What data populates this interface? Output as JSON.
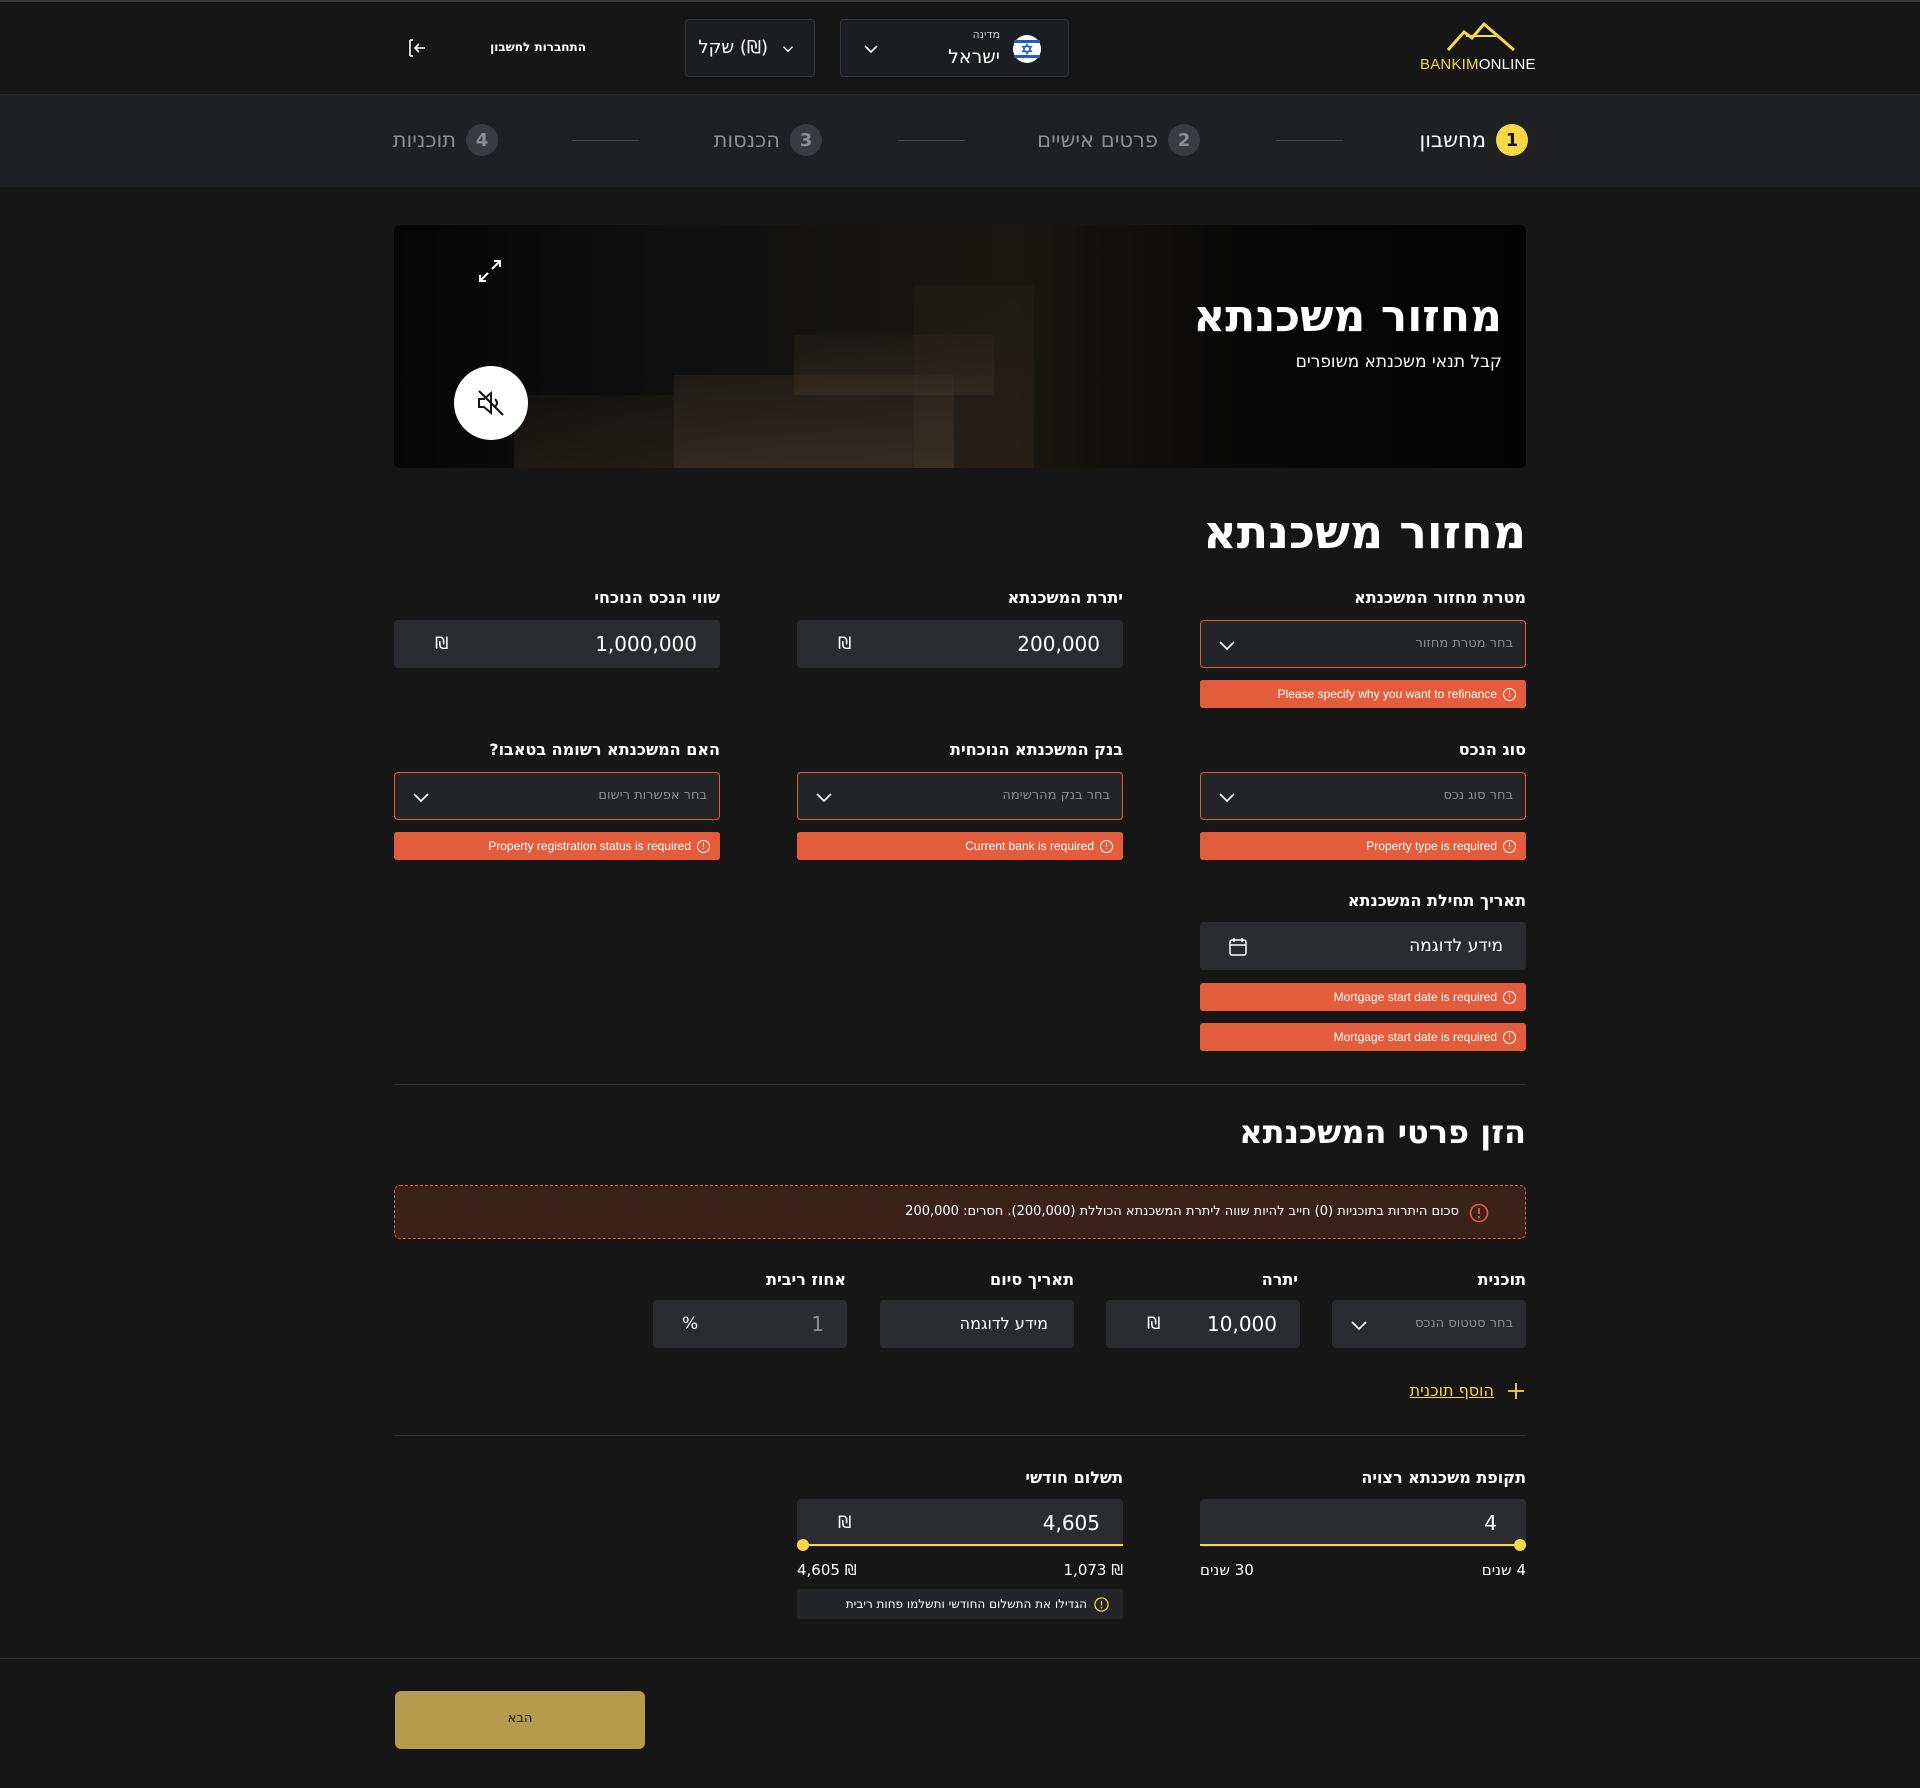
{
  "header": {
    "logo_part1": "BANKIM",
    "logo_part2": "ONLINE",
    "country_label": "מדינה",
    "country_value": "ישראל",
    "currency_value": "(₪) שקל",
    "login_label": "התחברות לחשבון"
  },
  "steps": [
    {
      "num": "1",
      "label": "מחשבון"
    },
    {
      "num": "2",
      "label": "פרטים אישיים"
    },
    {
      "num": "3",
      "label": "הכנסות"
    },
    {
      "num": "4",
      "label": "תוכניות"
    }
  ],
  "hero": {
    "title": "מחזור משכנתא",
    "subtitle": "קבל תנאי משכנתא משופרים"
  },
  "form": {
    "title": "מחזור משכנתא",
    "currency_symbol": "₪",
    "purpose": {
      "label": "מטרת מחזור המשכנתא",
      "placeholder": "בחר מטרת מחזור",
      "error": "Please specify why you want to refinance"
    },
    "balance": {
      "label": "יתרת המשכנתא",
      "value": "200,000"
    },
    "property_value": {
      "label": "שווי הנכס הנוכחי",
      "value": "1,000,000"
    },
    "property_type": {
      "label": "סוג הנכס",
      "placeholder": "בחר סוג נכס",
      "error": "Property type is required"
    },
    "current_bank": {
      "label": "בנק המשכנתא הנוכחית",
      "placeholder": "בחר בנק מהרשימה",
      "error": "Current bank is required"
    },
    "registration": {
      "label": "האם המשכנתא רשומה בטאבו?",
      "placeholder": "בחר אפשרות רישום",
      "error": "Property registration status is required"
    },
    "start_date": {
      "label": "תאריך תחילת המשכנתא",
      "value": "מידע לדוגמה",
      "error1": "Mortgage start date is required",
      "error2": "Mortgage start date is required"
    }
  },
  "details": {
    "title": "הזן פרטי המשכנתא",
    "warning": "סכום היתרות בתוכניות (0) חייב להיות שווה ליתרת המשכנתא הכוללת (200,000). חסרים: 200,000",
    "plan_label": "תוכנית",
    "plan_placeholder": "בחר סטטוס הנכס",
    "balance_label": "יתרה",
    "balance_value": "10,000",
    "end_date_label": "תאריך סיום",
    "end_date_value": "מידע לדוגמה",
    "rate_label": "אחוז ריבית",
    "rate_value": "1",
    "rate_symbol": "%",
    "add_plan": "הוסף תוכנית"
  },
  "period": {
    "label": "תקופת משכנתא רצויה",
    "value": "4",
    "min_label": "4 שנים",
    "max_label": "30 שנים",
    "slider_fraction": 0.0
  },
  "payment": {
    "label": "תשלום חודשי",
    "value": "4,605",
    "min_label": "₪ 1,073",
    "max_label": "₪ 4,605",
    "slider_fraction": 1.0,
    "hint": "הגדילו את התשלום החודשי ותשלמו פחות ריבית"
  },
  "footer": {
    "next_label": "הבא"
  },
  "colors": {
    "accent": "#f8d749",
    "error": "#e35d3c",
    "next_button": "#b69a4e"
  }
}
